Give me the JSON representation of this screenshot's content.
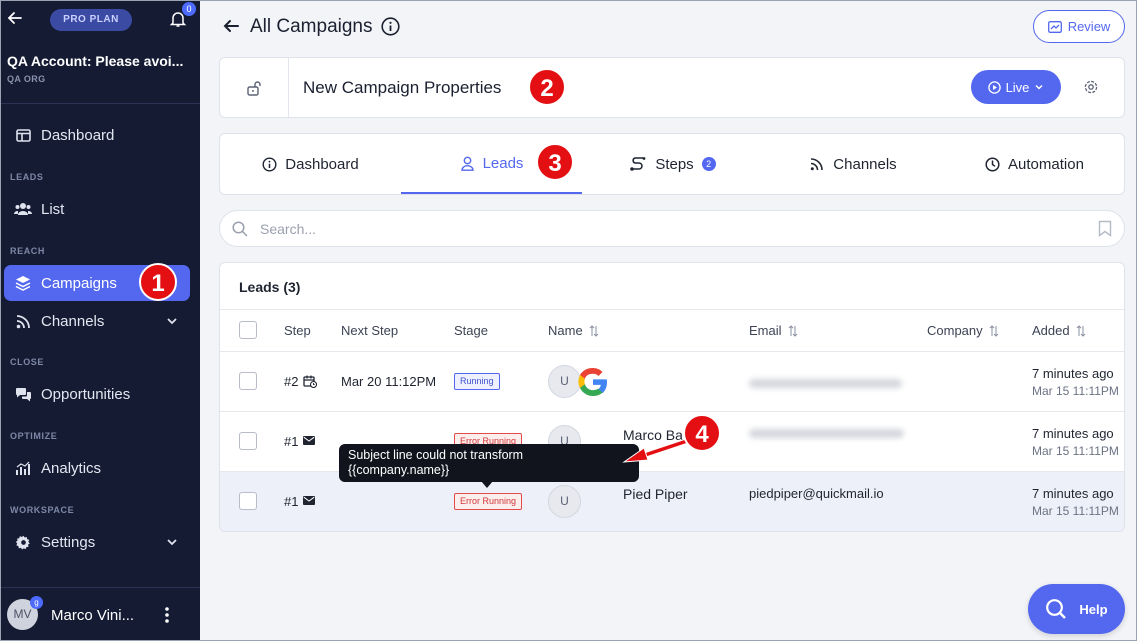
{
  "sidebar": {
    "plan_badge": "PRO PLAN",
    "notification_count": "0",
    "account_name": "QA Account: Please avoi...",
    "org_name": "QA ORG",
    "sections": {
      "leads": "LEADS",
      "reach": "REACH",
      "close": "CLOSE",
      "optimize": "OPTIMIZE",
      "workspace": "WORKSPACE"
    },
    "items": {
      "dashboard": "Dashboard",
      "list": "List",
      "campaigns": "Campaigns",
      "channels": "Channels",
      "opportunities": "Opportunities",
      "analytics": "Analytics",
      "settings": "Settings"
    },
    "user": {
      "initials": "MV",
      "badge": "g",
      "name": "Marco Vini..."
    }
  },
  "header": {
    "title": "All Campaigns",
    "review_label": "Review"
  },
  "campaign": {
    "title": "New Campaign Properties",
    "live_label": "Live"
  },
  "tabs": {
    "dashboard": "Dashboard",
    "leads": "Leads",
    "steps": "Steps",
    "steps_count": "2",
    "channels": "Channels",
    "automation": "Automation"
  },
  "search": {
    "placeholder": "Search..."
  },
  "leads_table": {
    "title": "Leads (3)",
    "columns": {
      "step": "Step",
      "next_step": "Next Step",
      "stage": "Stage",
      "name": "Name",
      "email": "Email",
      "company": "Company",
      "added": "Added"
    },
    "rows": [
      {
        "step": "#2",
        "next_step": "Mar 20 11:12PM",
        "stage": "Running",
        "avatar": "U",
        "name": "",
        "email": "",
        "company": "",
        "added": "7 minutes ago",
        "added_date": "Mar 15 11:11PM"
      },
      {
        "step": "#1",
        "next_step": "",
        "stage": "Error Running",
        "avatar": "U",
        "name": "Marco Ba",
        "email": "",
        "company": "",
        "added": "7 minutes ago",
        "added_date": "Mar 15 11:11PM"
      },
      {
        "step": "#1",
        "next_step": "",
        "stage": "Error Running",
        "avatar": "U",
        "name": "Pied Piper",
        "email": "piedpiper@quickmail.io",
        "company": "",
        "added": "7 minutes ago",
        "added_date": "Mar 15 11:11PM"
      }
    ]
  },
  "tooltip": {
    "line1": "Subject line could not transform",
    "line2": "{{company.name}}"
  },
  "annotations": {
    "m1": "1",
    "m2": "2",
    "m3": "3",
    "m4": "4"
  },
  "help_label": "Help",
  "colors": {
    "sidebar_bg": "#141b33",
    "accent": "#5468ef",
    "annotation_red": "#e40f12",
    "error_red": "#d23535"
  }
}
